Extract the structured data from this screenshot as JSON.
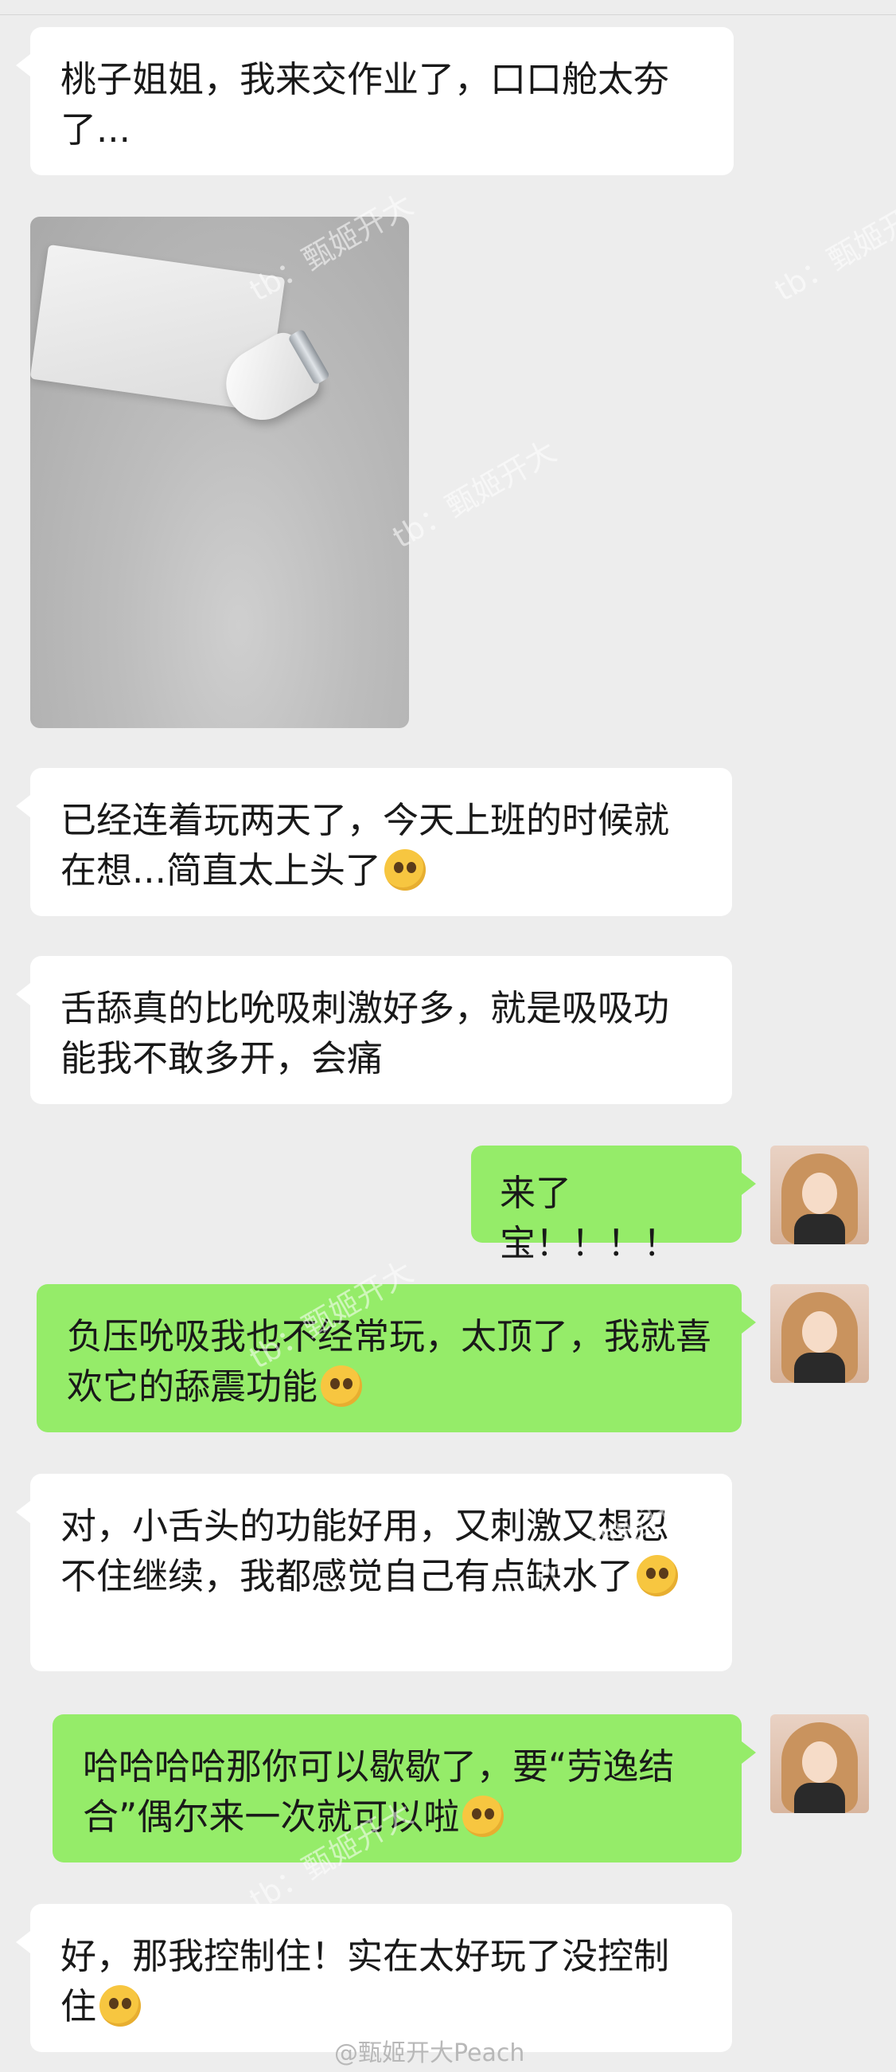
{
  "messages": [
    {
      "side": "left",
      "text": "桃子姐姐，我来交作业了，口口舱太夯了..."
    },
    {
      "side": "left",
      "text": "已经连着玩两天了，今天上班的时候就在想...简直太上头了"
    },
    {
      "side": "left",
      "text": "舌舔真的比吮吸刺激好多，就是吸吸功能我不敢多开，会痛"
    },
    {
      "side": "right",
      "text": "来了宝！！！！"
    },
    {
      "side": "right",
      "text": "负压吮吸我也不经常玩，太顶了，我就喜欢它的舔震功能"
    },
    {
      "side": "left",
      "text": "对，小舌头的功能好用，又刺激又想忍不住继续，我都感觉自己有点缺水了"
    },
    {
      "side": "right",
      "text": "哈哈哈哈那你可以歇歇了，要“劳逸结合”偶尔来一次就可以啦"
    },
    {
      "side": "left",
      "text": "好，那我控制住！实在太好玩了没控制住"
    }
  ],
  "watermarks": {
    "tb_text": "tb：甄姬开大",
    "signature": "@甄姬开大Peach"
  },
  "icons": {
    "emoji": "pleading-face-emoji",
    "emoji_tongue": "tongue-out-emoji",
    "emoji_wink": "wink-face-emoji"
  }
}
